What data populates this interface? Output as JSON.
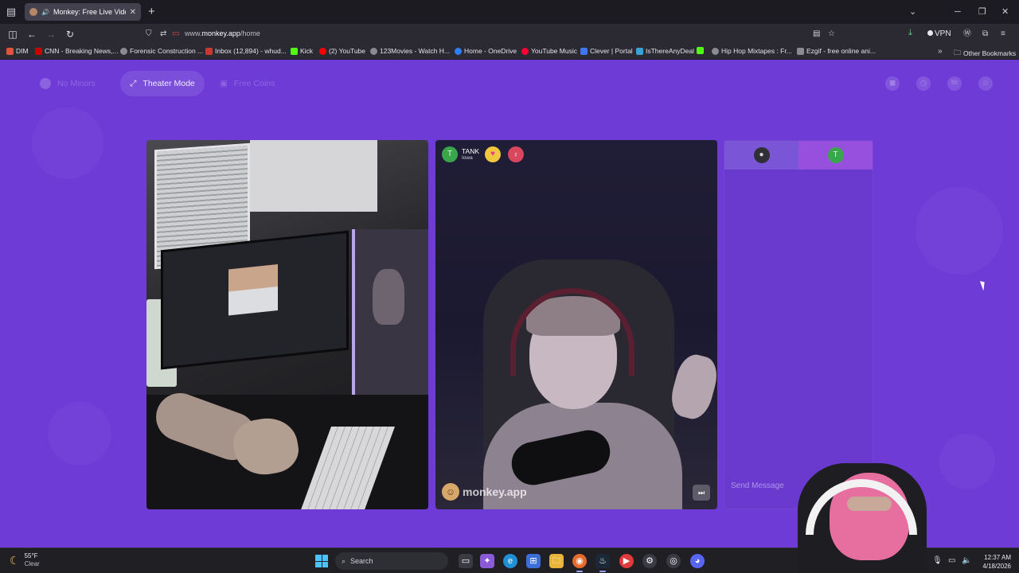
{
  "browser": {
    "tab": {
      "title": "Monkey: Free Live Video Ch",
      "close": "✕"
    },
    "new_tab": "+",
    "address": {
      "prefix": "www.",
      "host": "monkey.app",
      "path": "/home"
    },
    "vpn_label": "VPN",
    "window_controls": {
      "minimize": "─",
      "maximize": "❐",
      "close": "✕"
    }
  },
  "bookmarks": [
    {
      "label": "DIM",
      "color": "#e0533d"
    },
    {
      "label": "CNN - Breaking News,...",
      "color": "#cc0000"
    },
    {
      "label": "Forensic Construction ...",
      "color": "#8a8a95"
    },
    {
      "label": "Inbox (12,894) - whud...",
      "color": "#c9392f"
    },
    {
      "label": "Kick",
      "color": "#53fc18"
    },
    {
      "label": "(2) YouTube",
      "color": "#ff0000"
    },
    {
      "label": "123Movies - Watch H...",
      "color": "#8a8a95"
    },
    {
      "label": "Home - OneDrive",
      "color": "#2d7ff9"
    },
    {
      "label": "YouTube Music",
      "color": "#ff0033"
    },
    {
      "label": "Clever | Portal",
      "color": "#4274f6"
    },
    {
      "label": "IsThereAnyDeal",
      "color": "#3aa0d8"
    },
    {
      "label": "",
      "color": "#53fc18"
    },
    {
      "label": "Hip Hop Mixtapes : Fr...",
      "color": "#8a8a95"
    },
    {
      "label": "Ezgif - free online ani...",
      "color": "#8a8a95"
    }
  ],
  "other_bookmarks": "Other Bookmarks",
  "page": {
    "header": {
      "no_minors": "No Minors",
      "theater_mode": "Theater Mode",
      "free_coins": "Free Coins"
    },
    "remote_user": {
      "initial": "T",
      "name": "TANK",
      "location": "Iowa"
    },
    "watermark": "monkey.app",
    "chat": {
      "them_initial": "T",
      "placeholder": "Send Message"
    }
  },
  "taskbar": {
    "weather": {
      "temp": "55°F",
      "condition": "Clear"
    },
    "search_label": "Search",
    "clock": {
      "time": "12:37 AM",
      "date": "4/18/2026"
    }
  }
}
